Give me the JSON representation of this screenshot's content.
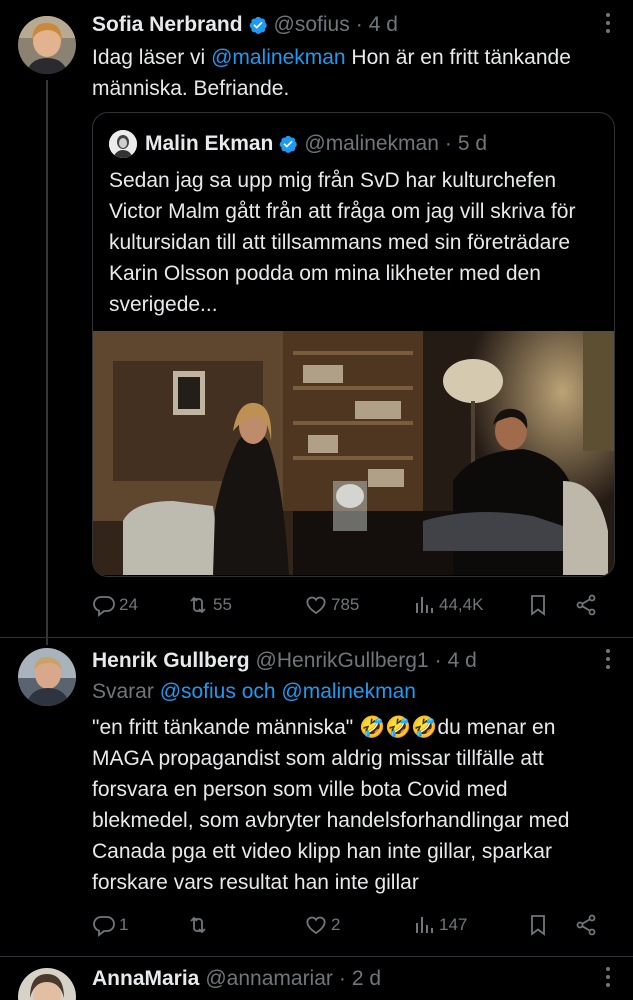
{
  "tweets": [
    {
      "name": "Sofia Nerbrand",
      "handle": "@sofius",
      "time": "4 d",
      "text_prefix": "Idag läser vi ",
      "mention": "@malinekman",
      "text_suffix": "  Hon är en fritt tänkande människa. Befriande.",
      "quote": {
        "name": "Malin Ekman",
        "handle": "@malinekman",
        "time": "5 d",
        "text": "Sedan jag sa upp mig från SvD har kulturchefen Victor Malm gått från att fråga om jag vill skriva för kultursidan till att tillsammans med sin företrädare Karin Olsson podda om mina likheter med den sverigede..."
      },
      "stats": {
        "replies": "24",
        "reposts": "55",
        "likes": "785",
        "views": "44,4K"
      }
    },
    {
      "name": "Henrik Gullberg",
      "handle": "@HenrikGullberg1",
      "time": "4 d",
      "reply_label": "Svarar ",
      "reply_to": "@sofius och @malinekman",
      "text": "\"en fritt tänkande människa\" 🤣🤣🤣du menar en MAGA propagandist som aldrig missar tillfälle att forsvara en person som ville bota Covid med blekmedel, som avbryter handelsforhandlingar med Canada pga ett video klipp han inte gillar, sparkar forskare vars resultat han inte gillar",
      "stats": {
        "replies": "1",
        "reposts": "",
        "likes": "2",
        "views": "147"
      }
    },
    {
      "name": "AnnaMaria",
      "handle": "@annamariar",
      "time": "2 d"
    }
  ],
  "icons": {
    "verified": "verified-badge-icon",
    "more": "more-options-icon",
    "reply": "reply-icon",
    "repost": "repost-icon",
    "like": "heart-icon",
    "views": "views-icon",
    "bookmark": "bookmark-icon",
    "share": "share-icon"
  },
  "colors": {
    "accent": "#1d9bf0",
    "muted": "#71767b",
    "text": "#e7e9ea",
    "bg": "#000000",
    "border": "#2f3336"
  }
}
